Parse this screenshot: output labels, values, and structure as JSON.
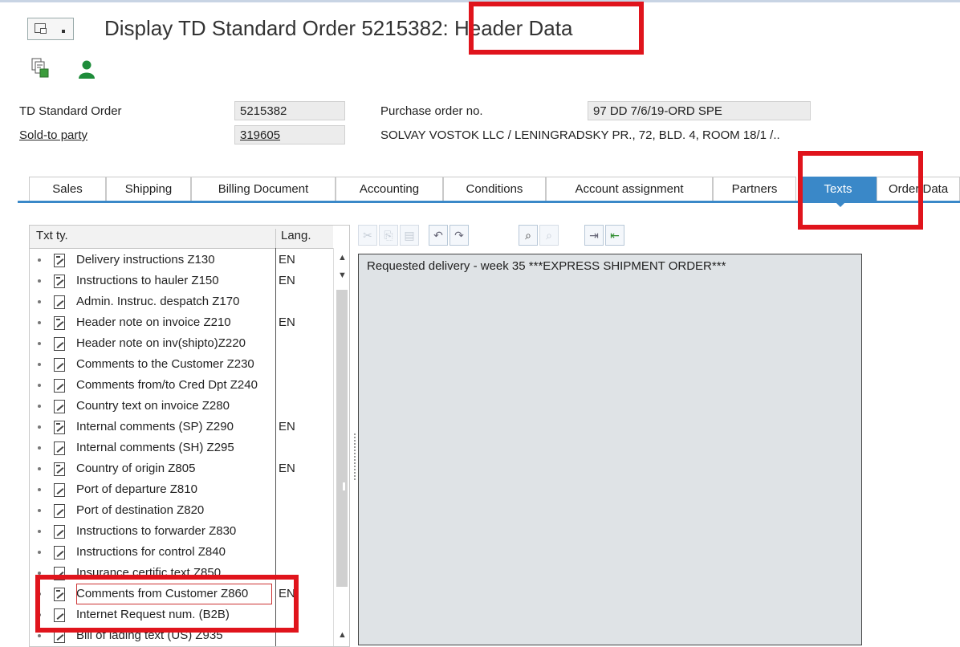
{
  "title": "Display TD Standard Order 5215382: Header Data",
  "header": {
    "order_type_label": "TD Standard Order",
    "order_number": "5215382",
    "sold_to_label": "Sold-to party",
    "sold_to_value": "319605",
    "po_label": "Purchase order no.",
    "po_value": "97 DD 7/6/19-ORD SPE",
    "customer_desc": "SOLVAY VOSTOK LLC / LENINGRADSKY PR., 72, BLD. 4, ROOM 18/1 /.."
  },
  "tabs": [
    {
      "label": "Sales",
      "active": false
    },
    {
      "label": "Shipping",
      "active": false
    },
    {
      "label": "Billing Document",
      "active": false
    },
    {
      "label": "Accounting",
      "active": false
    },
    {
      "label": "Conditions",
      "active": false
    },
    {
      "label": "Account assignment",
      "active": false
    },
    {
      "label": "Partners",
      "active": false
    },
    {
      "label": "Texts",
      "active": true
    },
    {
      "label": "Order Data",
      "active": false
    }
  ],
  "text_list": {
    "col_type": "Txt ty.",
    "col_lang": "Lang.",
    "items": [
      {
        "label": "Delivery instructions Z130",
        "lang": "EN",
        "has_text": true
      },
      {
        "label": "Instructions to hauler Z150",
        "lang": "EN",
        "has_text": true
      },
      {
        "label": "Admin. Instruc. despatch Z170",
        "lang": "",
        "has_text": false
      },
      {
        "label": "Header note on invoice Z210",
        "lang": "EN",
        "has_text": true
      },
      {
        "label": "Header note on inv(shipto)Z220",
        "lang": "",
        "has_text": false
      },
      {
        "label": "Comments to the Customer Z230",
        "lang": "",
        "has_text": false
      },
      {
        "label": "Comments from/to Cred Dpt Z240",
        "lang": "",
        "has_text": false
      },
      {
        "label": "Country text on invoice Z280",
        "lang": "",
        "has_text": false
      },
      {
        "label": "Internal comments (SP) Z290",
        "lang": "EN",
        "has_text": true
      },
      {
        "label": "Internal comments (SH) Z295",
        "lang": "",
        "has_text": false
      },
      {
        "label": "Country of origin Z805",
        "lang": "EN",
        "has_text": true
      },
      {
        "label": "Port of departure Z810",
        "lang": "",
        "has_text": false
      },
      {
        "label": "Port of destination Z820",
        "lang": "",
        "has_text": false
      },
      {
        "label": "Instructions to forwarder Z830",
        "lang": "",
        "has_text": false
      },
      {
        "label": "Instructions for control Z840",
        "lang": "",
        "has_text": false
      },
      {
        "label": "Insurance certific.text Z850",
        "lang": "",
        "has_text": false
      },
      {
        "label": "Comments from Customer Z860",
        "lang": "EN",
        "has_text": true,
        "selected": true
      },
      {
        "label": "Internet Request num. (B2B)",
        "lang": "",
        "has_text": false
      },
      {
        "label": "Bill of lading text (US) Z935",
        "lang": "",
        "has_text": false
      }
    ]
  },
  "editor": {
    "content": "Requested delivery - week 35 ***EXPRESS SHIPMENT ORDER***"
  },
  "editor_toolbar_icons": [
    "cut-icon",
    "copy-icon",
    "paste-icon",
    "undo-icon",
    "redo-icon",
    "find-icon",
    "find-next-icon",
    "import-icon",
    "export-icon"
  ],
  "colors": {
    "tab_active": "#3a88c8",
    "highlight": "#e0141c",
    "editor_bg": "#dfe3e6"
  }
}
